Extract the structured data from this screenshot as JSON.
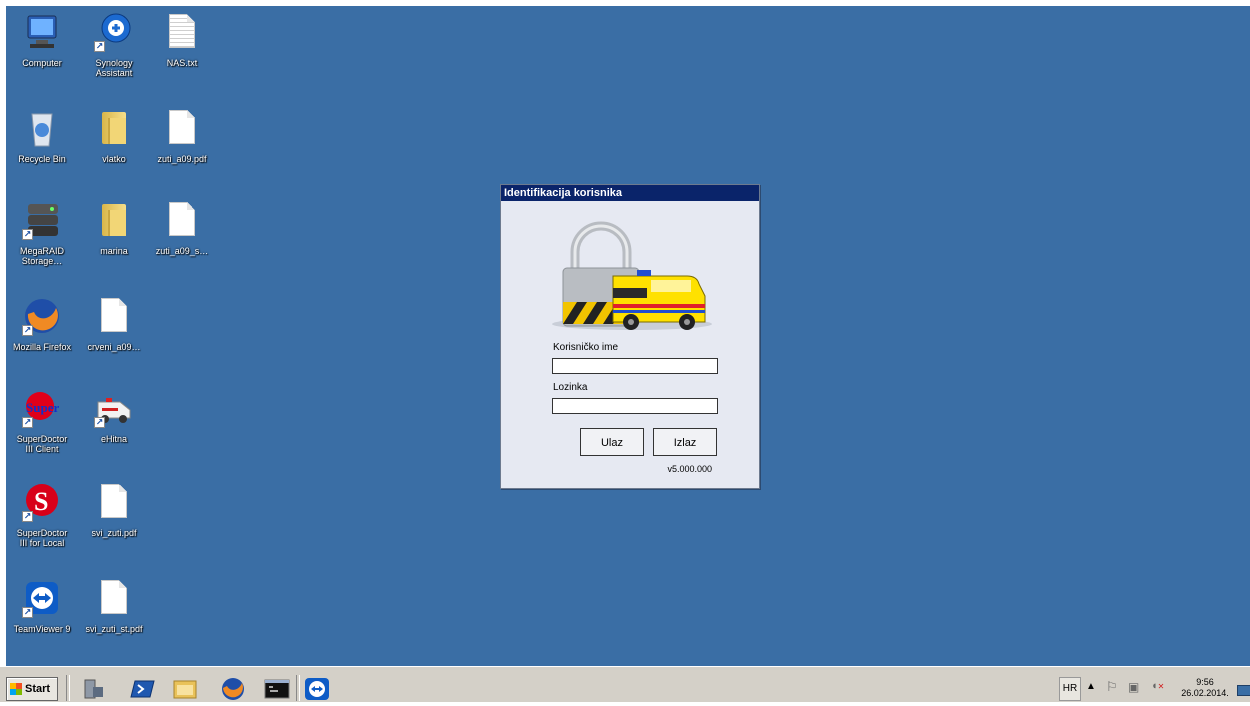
{
  "desktop": {
    "icons": [
      {
        "label": "Computer",
        "icon": "computer-icon"
      },
      {
        "label": "Synology\nAssistant",
        "icon": "synology-assistant-icon"
      },
      {
        "label": "NAS.txt",
        "icon": "text-file-icon"
      },
      {
        "label": "Recycle Bin",
        "icon": "recycle-bin-icon"
      },
      {
        "label": "vlatko",
        "icon": "folder-icon"
      },
      {
        "label": "zuti_a09.pdf",
        "icon": "pdf-file-icon"
      },
      {
        "label": "MegaRAID\nStorage…",
        "icon": "megaraid-icon"
      },
      {
        "label": "marina",
        "icon": "folder-icon"
      },
      {
        "label": "zuti_a09_s…",
        "icon": "pdf-file-icon"
      },
      {
        "label": "Mozilla Firefox",
        "icon": "firefox-icon"
      },
      {
        "label": "crveni_a09…",
        "icon": "pdf-file-icon"
      },
      {
        "label": "SuperDoctor\nIII Client",
        "icon": "superdoctor-client-icon"
      },
      {
        "label": "eHitna",
        "icon": "ambulance-icon"
      },
      {
        "label": "SuperDoctor\nIII for Local",
        "icon": "superdoctor-local-icon"
      },
      {
        "label": "svi_zuti.pdf",
        "icon": "pdf-file-icon"
      },
      {
        "label": "TeamViewer 9",
        "icon": "teamviewer-icon"
      },
      {
        "label": "svi_zuti_st.pdf",
        "icon": "pdf-file-icon"
      }
    ]
  },
  "dialog": {
    "title": "Identifikacija korisnika",
    "username_label": "Korisničko ime",
    "username_value": "",
    "password_label": "Lozinka",
    "password_value": "",
    "login_button": "Ulaz",
    "exit_button": "Izlaz",
    "version": "v5.000.000"
  },
  "taskbar": {
    "start_label": "Start",
    "pinned": [
      "server-manager-icon",
      "powershell-icon",
      "file-explorer-icon",
      "firefox-icon",
      "command-prompt-icon",
      "teamviewer-icon"
    ],
    "tray": {
      "language": "HR",
      "time": "9:56",
      "date": "26.02.2014."
    }
  }
}
